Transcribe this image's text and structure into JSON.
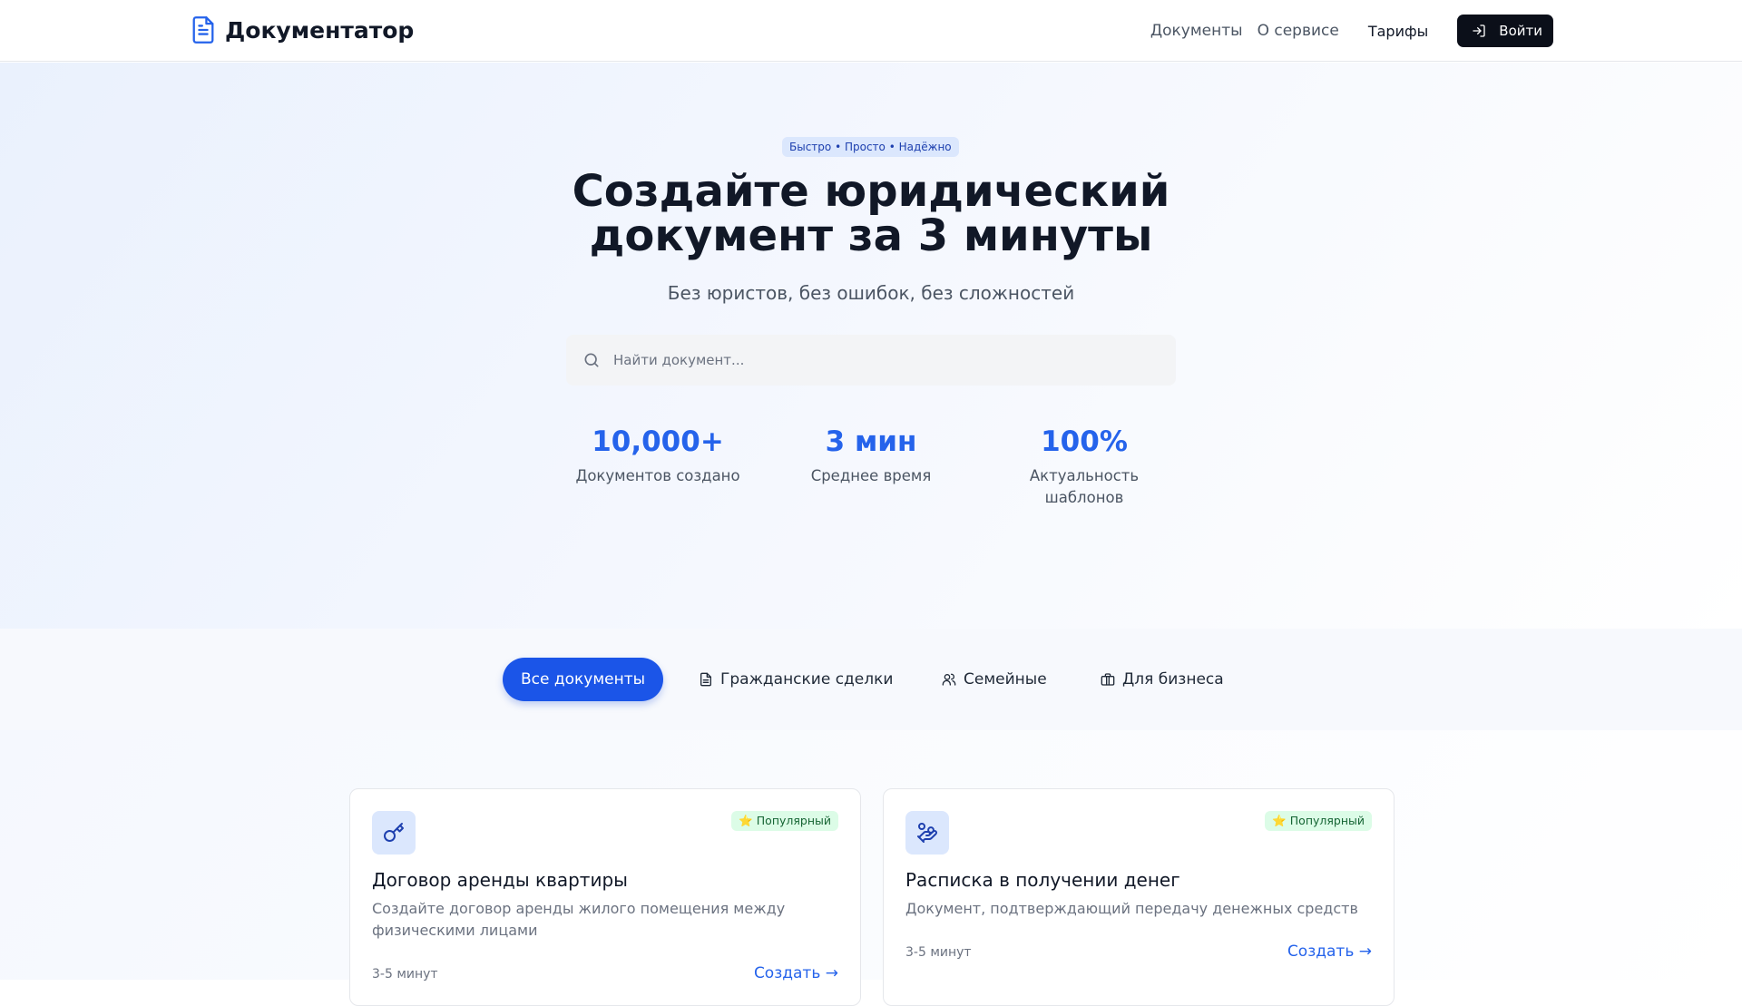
{
  "header": {
    "logo_text": "Документатор",
    "nav": [
      "Документы",
      "О сервисе"
    ],
    "pricing": "Тарифы",
    "login": "Войти"
  },
  "hero": {
    "badge": "Быстро • Просто • Надёжно",
    "title_line1": "Создайте юридический",
    "title_line2": "документ за 3 минуты",
    "subtitle": "Без юристов, без ошибок, без сложностей",
    "search_placeholder": "Найти документ...",
    "stats": [
      {
        "value": "10,000+",
        "label": "Документов создано"
      },
      {
        "value": "3 мин",
        "label": "Среднее время"
      },
      {
        "value": "100%",
        "label_line1": "Актуальность",
        "label_line2": "шаблонов"
      }
    ]
  },
  "tabs": [
    "Все документы",
    "Гражданские сделки",
    "Семейные",
    "Для бизнеса"
  ],
  "cards": [
    {
      "icon": "key-icon",
      "badge": "⭐ Популярный",
      "title": "Договор аренды квартиры",
      "desc": "Создайте договор аренды жилого помещения между физическими лицами",
      "time": "3-5 минут",
      "link": "Создать →"
    },
    {
      "icon": "hand-coins-icon",
      "badge": "⭐ Популярный",
      "title": "Расписка в получении денег",
      "desc": "Документ, подтверждающий передачу денежных средств",
      "time": "3-5 минут",
      "link": "Создать →"
    }
  ],
  "colors": {
    "accent": "#2563eb",
    "login_bg": "#0b0f19",
    "active_tab": "#1b55e8",
    "popular_bg": "#dcfce7"
  }
}
